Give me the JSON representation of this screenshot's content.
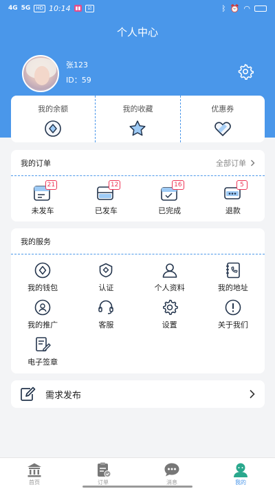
{
  "status_bar": {
    "network_1": "4G",
    "network_2": "5G",
    "hd": "HD",
    "time": "10:14",
    "battery": ""
  },
  "header": {
    "title": "个人中心"
  },
  "profile": {
    "name": "张123",
    "id_text": "ID：59"
  },
  "stats": [
    {
      "label": "我的余额",
      "icon": "wallet-diamond-icon"
    },
    {
      "label": "我的收藏",
      "icon": "star-icon"
    },
    {
      "label": "优惠券",
      "icon": "coupon-heart-icon"
    }
  ],
  "orders": {
    "title": "我的订单",
    "all_link": "全部订单",
    "items": [
      {
        "label": "未发车",
        "count": "21",
        "icon": "unshipped-icon"
      },
      {
        "label": "已发车",
        "count": "12",
        "icon": "shipped-icon"
      },
      {
        "label": "已完成",
        "count": "16",
        "icon": "completed-icon"
      },
      {
        "label": "退款",
        "count": "5",
        "icon": "refund-icon"
      }
    ]
  },
  "services": {
    "title": "我的服务",
    "items": [
      {
        "label": "我的钱包",
        "icon": "wallet-icon"
      },
      {
        "label": "认证",
        "icon": "certification-icon"
      },
      {
        "label": "个人资料",
        "icon": "person-icon"
      },
      {
        "label": "我的地址",
        "icon": "address-book-icon"
      },
      {
        "label": "我的推广",
        "icon": "promotion-icon"
      },
      {
        "label": "客服",
        "icon": "headset-icon"
      },
      {
        "label": "设置",
        "icon": "gear-icon"
      },
      {
        "label": "关于我们",
        "icon": "info-icon"
      },
      {
        "label": "电子签章",
        "icon": "signature-icon"
      }
    ]
  },
  "publish": {
    "label": "需求发布"
  },
  "tabbar": {
    "tabs": [
      {
        "label": "首页",
        "icon": "home-icon",
        "active": false
      },
      {
        "label": "订单",
        "icon": "order-icon",
        "active": false
      },
      {
        "label": "消息",
        "icon": "message-icon",
        "active": false
      },
      {
        "label": "我的",
        "icon": "profile-icon",
        "active": true
      }
    ]
  },
  "colors": {
    "primary": "#4a97ea",
    "badge": "#ee3355",
    "background": "#f3f4f6"
  }
}
